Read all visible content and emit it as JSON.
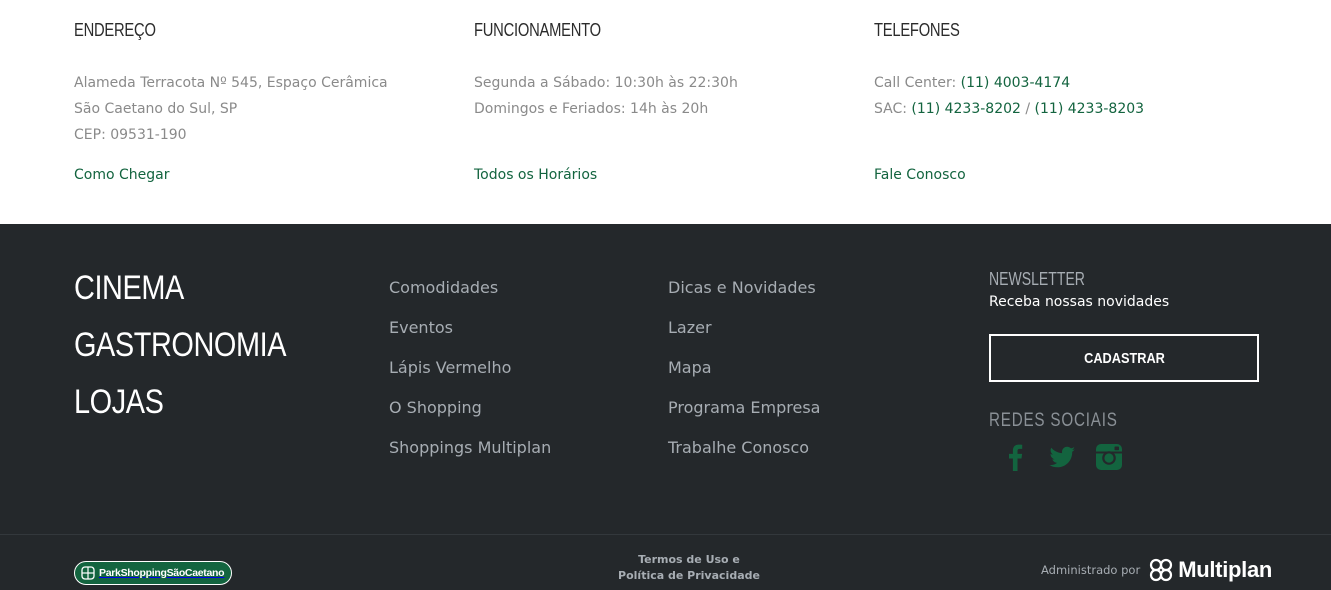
{
  "info": {
    "address": {
      "title": "ENDEREÇO",
      "line1": "Alameda Terracota Nº 545, Espaço Cerâmica",
      "line2": "São Caetano do Sul, SP",
      "line3": "CEP: 09531-190",
      "link": "Como Chegar"
    },
    "hours": {
      "title": "FUNCIONAMENTO",
      "line1": "Segunda a Sábado: 10:30h às 22:30h",
      "line2": "Domingos e Feriados: 14h às 20h",
      "link": "Todos os Horários"
    },
    "phones": {
      "title": "TELEFONES",
      "call_center_label": "Call Center: ",
      "call_center_number": "(11) 4003-4174",
      "sac_label": "SAC: ",
      "sac_number_1": "(11) 4233-8202",
      "sac_separator": " / ",
      "sac_number_2": "(11) 4233-8203",
      "link": "Fale Conosco"
    }
  },
  "footer": {
    "big_nav": [
      "CINEMA",
      "GASTRONOMIA",
      "LOJAS"
    ],
    "nav_col_a": [
      "Comodidades",
      "Eventos",
      "Lápis Vermelho",
      "O Shopping",
      "Shoppings Multiplan"
    ],
    "nav_col_b": [
      "Dicas e Novidades",
      "Lazer",
      "Mapa",
      "Programa Empresa",
      "Trabalhe Conosco"
    ],
    "newsletter": {
      "title": "NEWSLETTER",
      "subtitle": "Receba nossas novidades",
      "button": "CADASTRAR"
    },
    "social": {
      "title": "REDES SOCIAIS",
      "icons": [
        "facebook-icon",
        "twitter-icon",
        "instagram-icon"
      ],
      "color": "#13643f"
    },
    "bottom": {
      "logo_text": "ParkShoppingSãoCaetano",
      "terms": "Termos de Uso e",
      "privacy": "Política de Privacidade",
      "admin_label": "Administrado por",
      "admin_brand": "Multiplan"
    }
  },
  "colors": {
    "accent_green": "#13643f",
    "footer_bg": "#24282b",
    "muted_text": "#a7adb3"
  }
}
